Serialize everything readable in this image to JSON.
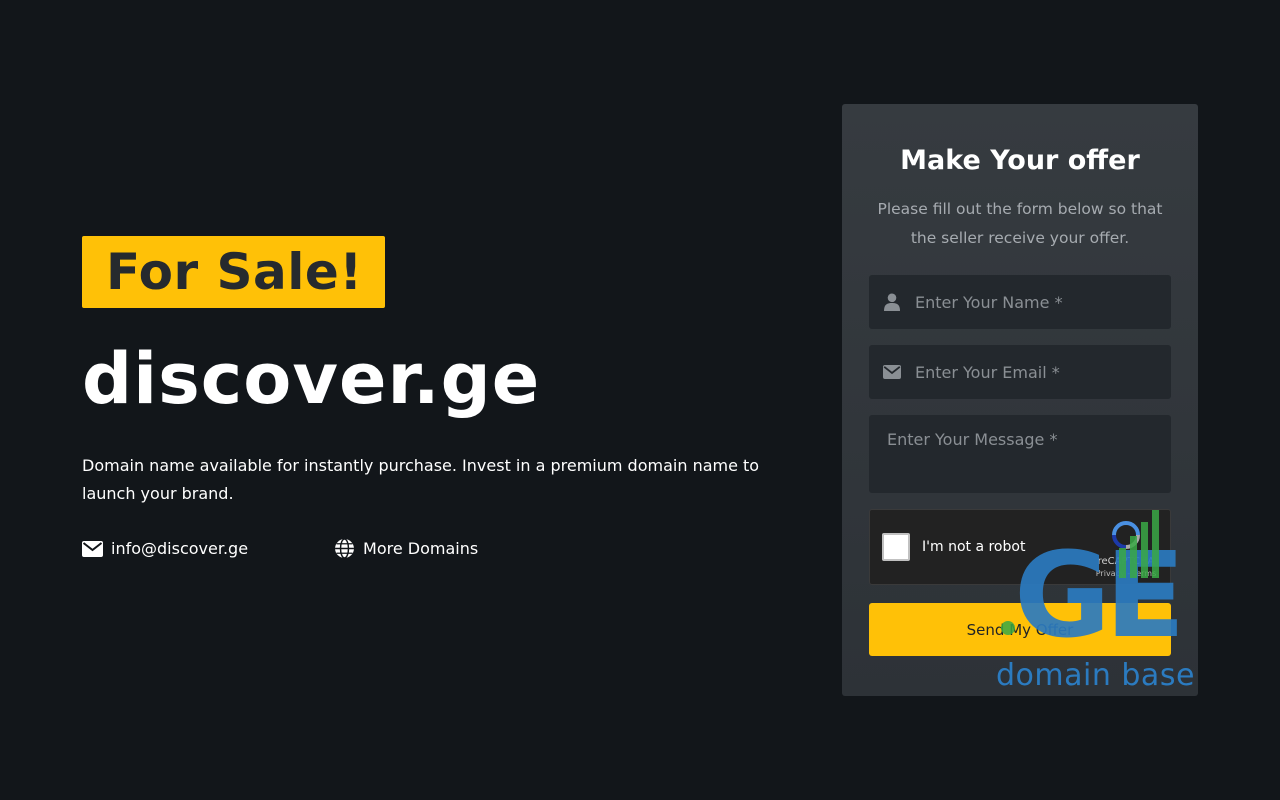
{
  "hero": {
    "badge": "For Sale!",
    "domain": "discover.ge",
    "description": "Domain name available for instantly purchase. Invest in a premium domain name to launch your brand.",
    "email": "info@discover.ge",
    "more_domains": "More Domains"
  },
  "offer_form": {
    "title": "Make Your offer",
    "subtitle": "Please fill out the form below so that the seller receive your offer.",
    "name_placeholder": "Enter Your Name *",
    "email_placeholder": "Enter Your Email *",
    "message_placeholder": "Enter Your Message *",
    "captcha": {
      "label": "I'm not a robot",
      "brand": "reCAPTCHA",
      "terms": "Privacy - Terms"
    },
    "submit_label": "Send My Offer"
  },
  "watermark": {
    "logo_text": "GE",
    "caption": "domain base"
  },
  "colors": {
    "background": "#12161a",
    "accent": "#ffc107",
    "card": "#363b40",
    "input": "#23282d",
    "watermark_blue": "#2b7bc0",
    "watermark_green": "#3aa845"
  },
  "icons": {
    "name_field": "user-icon",
    "email_field": "envelope-icon",
    "email_link": "envelope-icon",
    "more_domains": "globe-icon"
  }
}
